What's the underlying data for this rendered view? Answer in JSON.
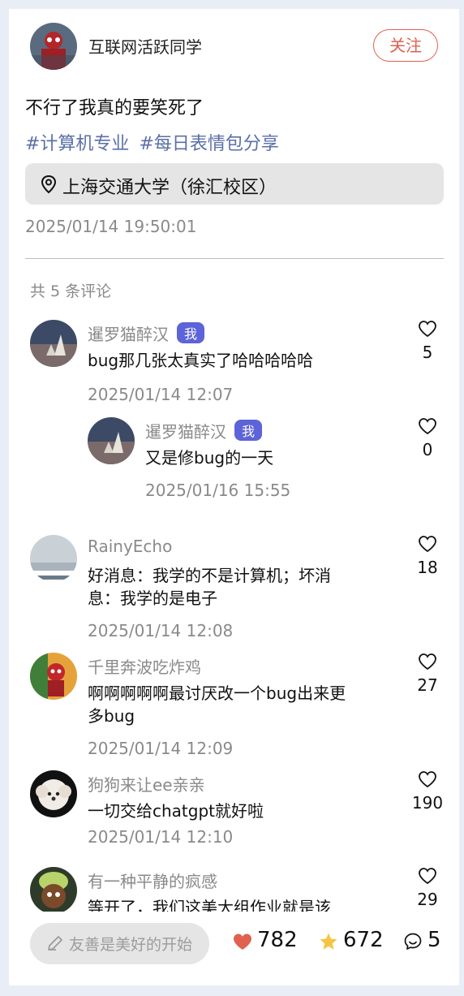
{
  "post": {
    "author": "互联网活跃同学",
    "follow_label": "关注",
    "text": "不行了我真的要笑死了",
    "tags": [
      "#计算机专业",
      "#每日表情包分享"
    ],
    "location": "上海交通大学（徐汇校区）",
    "time": "2025/01/14 19:50:01",
    "comment_count_label": "共 5 条评论"
  },
  "comments": [
    {
      "name": "暹罗猫醉汉",
      "badge": "我",
      "text": "bug那几张太真实了哈哈哈哈哈",
      "time": "2025/01/14 12:07",
      "likes": "5"
    },
    {
      "name": "暹罗猫醉汉",
      "badge": "我",
      "text": "又是修bug的一天",
      "time": "2025/01/16 15:55",
      "likes": "0"
    },
    {
      "name": "RainyEcho",
      "text": "好消息：我学的不是计算机；坏消息：我学的是电子",
      "time": "2025/01/14 12:08",
      "likes": "18"
    },
    {
      "name": "千里奔波吃炸鸡",
      "text": "啊啊啊啊啊最讨厌改一个bug出来更多bug",
      "time": "2025/01/14 12:09",
      "likes": "27"
    },
    {
      "name": "狗狗来让ee亲亲",
      "text": "一切交给chatgpt就好啦",
      "time": "2025/01/14 12:10",
      "likes": "190"
    },
    {
      "name": "有一种平静的疯感",
      "text": "等开了，我们这美大组作业就是该",
      "likes": "29"
    }
  ],
  "bottom": {
    "input_placeholder": "友善是美好的开始",
    "likes": "782",
    "stars": "672",
    "comments": "5"
  },
  "colors": {
    "accent_red": "#e0614f",
    "tag_blue": "#5b6fa8",
    "badge_purple": "#5d63d8",
    "star_yellow": "#f5c542"
  },
  "icons": [
    "location-pin-icon",
    "heart-outline-icon",
    "pen-icon",
    "heart-filled-icon",
    "star-filled-icon",
    "comment-bubble-icon"
  ]
}
